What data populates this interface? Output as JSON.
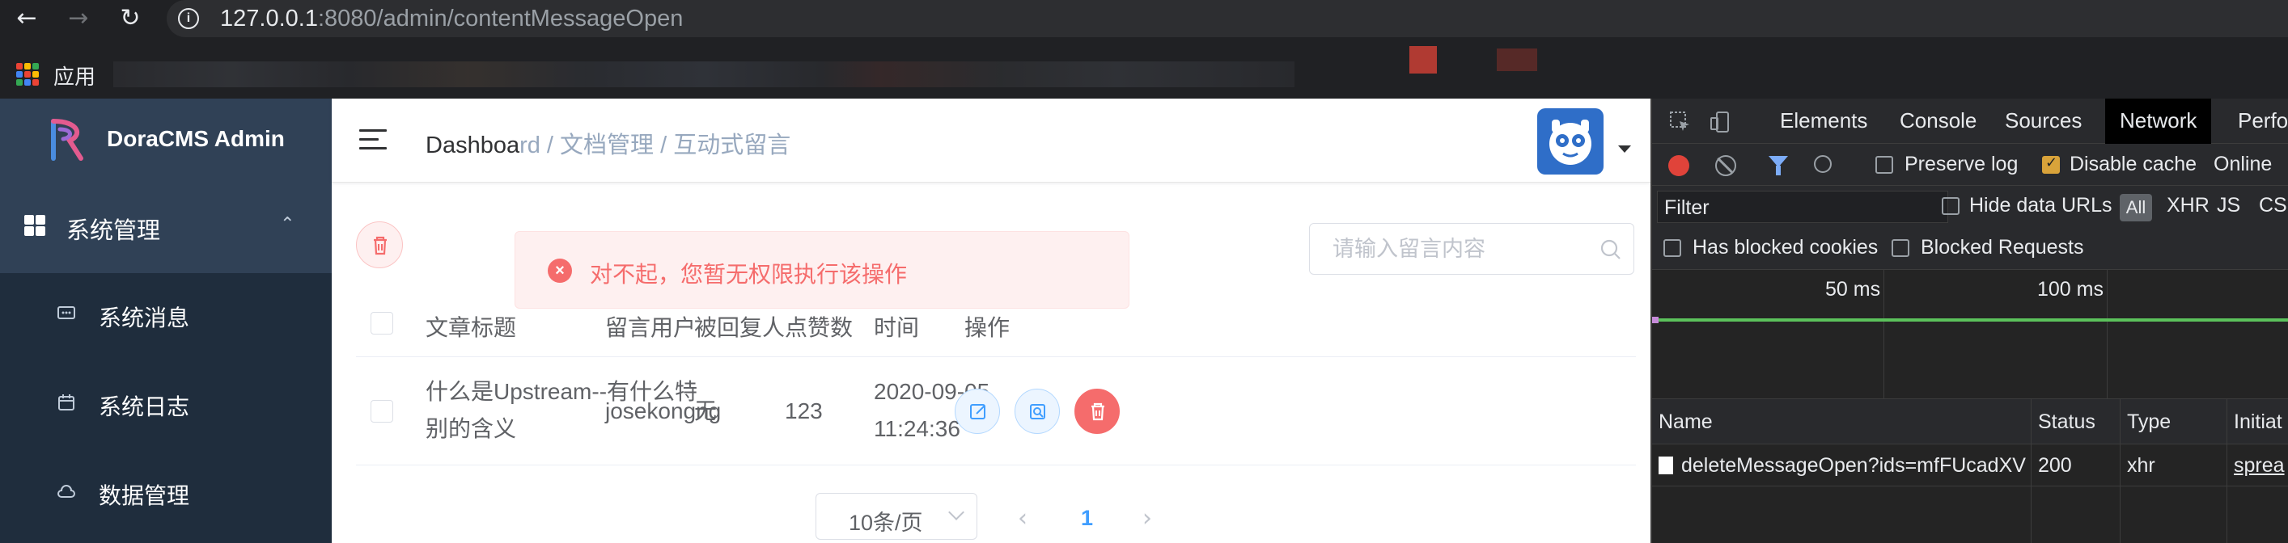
{
  "browser": {
    "url_host": "127.0.0.1",
    "url_path": ":8080/admin/contentMessageOpen",
    "bookmarks_label": "应用"
  },
  "sidebar": {
    "brand": "DoraCMS Admin",
    "group": {
      "label": "系统管理"
    },
    "items": [
      {
        "label": "系统消息",
        "icon": "message-icon"
      },
      {
        "label": "系统日志",
        "icon": "calendar-icon"
      },
      {
        "label": "数据管理",
        "icon": "cloud-icon"
      }
    ]
  },
  "topbar": {
    "breadcrumb_first": "Dashboa",
    "breadcrumb_hidden": "rd / 文档管理 / 互动式留言"
  },
  "toast": {
    "message": "对不起，您暂无权限执行该操作",
    "type": "error"
  },
  "search": {
    "placeholder": "请输入留言内容"
  },
  "table": {
    "columns": [
      "文章标题",
      "留言用户",
      "被回复人",
      "点赞数",
      "时间",
      "操作"
    ],
    "rows": [
      {
        "title_line1": "什么是Upstream--有什么特",
        "title_line2": "别的含义",
        "user": "josekongng",
        "replied_to": "无",
        "likes": "123",
        "date": "2020-09-05",
        "time": "11:24:36"
      }
    ]
  },
  "pagination": {
    "page_size": "10条/页",
    "current_page": "1"
  },
  "devtools": {
    "tabs": [
      "Elements",
      "Console",
      "Sources",
      "Network",
      "Perform"
    ],
    "active_tab": "Network",
    "preserve_log": "Preserve log",
    "disable_cache": "Disable cache",
    "online": "Online",
    "filter_label": "Filter",
    "hide_data_urls": "Hide data URLs",
    "type_all": "All",
    "type_xhr": "XHR",
    "type_js": "JS",
    "type_css": "CS",
    "has_blocked_cookies": "Has blocked cookies",
    "blocked_requests": "Blocked Requests",
    "timeline_50": "50 ms",
    "timeline_100": "100 ms",
    "columns": [
      "Name",
      "Status",
      "Type",
      "Initiat"
    ],
    "request": {
      "name": "deleteMessageOpen?ids=mfFUcadXV",
      "status": "200",
      "type": "xhr",
      "initiator": "sprea"
    }
  },
  "colors": {
    "sidebar_bg": "#304156",
    "submenu_bg": "#1f2d3d",
    "error": "#f56c6c",
    "primary": "#409eff"
  }
}
